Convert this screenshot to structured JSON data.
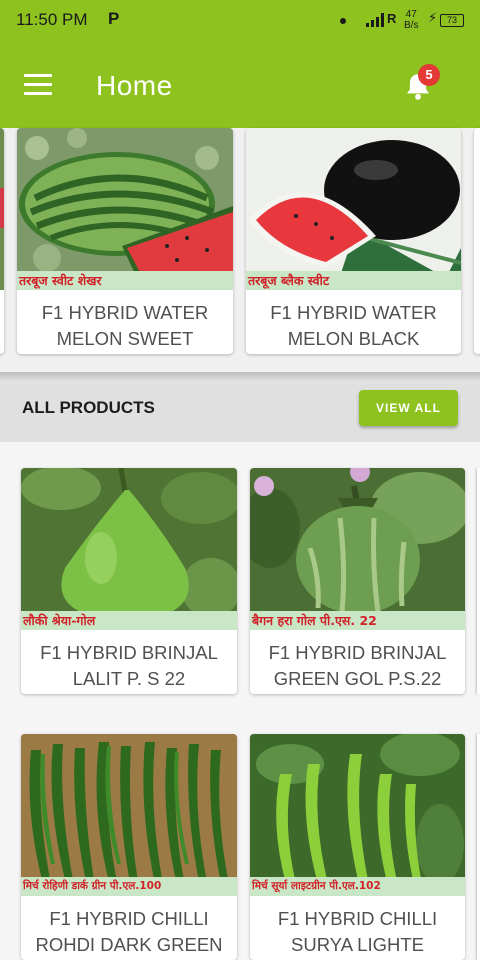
{
  "status_bar": {
    "time": "11:50 PM",
    "carrier_icon": "P",
    "network": "R",
    "speed_value": "47",
    "speed_unit": "B/s",
    "battery": "73",
    "icons": [
      "notification-dot-icon",
      "signal-icon",
      "charging-icon",
      "battery-icon"
    ]
  },
  "app_bar": {
    "title": "Home",
    "notification_count": "5",
    "icons": [
      "hamburger-menu-icon",
      "bell-icon"
    ],
    "color": "#8dc21f"
  },
  "featured": [
    {
      "strip_text": "तरबूज स्वीट शेखर",
      "name_line1": "F1 HYBRID WATER",
      "name_line2": "MELON SWEET"
    },
    {
      "strip_text": "तरबूज ब्लैक स्वीट",
      "name_line1": "F1 HYBRID WATER",
      "name_line2": "MELON BLACK"
    }
  ],
  "all_products": {
    "header": "ALL PRODUCTS",
    "view_all_label": "VIEW ALL",
    "items": [
      {
        "strip_text": "लौकी श्रेया-गोल",
        "name_line1": "F1 HYBRID BRINJAL",
        "name_line2": "LALIT P. S 22"
      },
      {
        "strip_text": "बैगन हरा गोल पी.एस. 22",
        "name_line1": "F1 HYBRID BRINJAL",
        "name_line2": "GREEN GOL P.S.22"
      },
      {
        "strip_text": "मिर्च रोहिणी डार्क ग्रीन पी.एल.100",
        "name_line1": "F1 HYBRID CHILLI",
        "name_line2": "ROHDI DARK GREEN"
      },
      {
        "strip_text": "मिर्च सूर्या लाइटग्रीन पी.एल.102",
        "name_line1": "F1 HYBRID CHILLI",
        "name_line2": "SURYA LIGHTE"
      }
    ]
  },
  "colors": {
    "accent": "#8dc21f",
    "strip_bg": "#c9e7c6",
    "strip_text": "#d1222a",
    "badge": "#e53935"
  }
}
